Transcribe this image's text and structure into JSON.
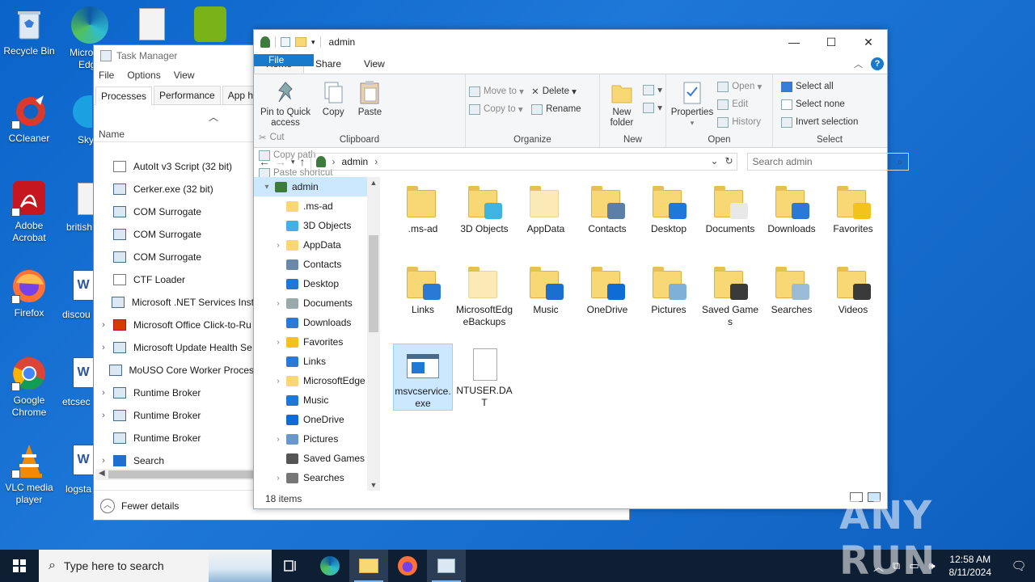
{
  "desktop": {
    "icons": [
      {
        "label": "Recycle Bin",
        "icon": "recycle-bin-icon"
      },
      {
        "label": "CCleaner",
        "icon": "ccleaner-icon"
      },
      {
        "label": "Adobe Acrobat",
        "icon": "adobe-acrobat-icon"
      },
      {
        "label": "Firefox",
        "icon": "firefox-icon"
      },
      {
        "label": "Google Chrome",
        "icon": "chrome-icon"
      },
      {
        "label": "VLC media player",
        "icon": "vlc-icon"
      }
    ],
    "partial_labels": [
      "Micro",
      "Edg",
      "Sky",
      "british",
      "discou",
      "etcsec",
      "logsta"
    ]
  },
  "taskmgr": {
    "title": "Task Manager",
    "menu": [
      "File",
      "Options",
      "View"
    ],
    "tabs": [
      "Processes",
      "Performance",
      "App histo"
    ],
    "column_name": "Name",
    "processes": [
      {
        "name": "AutoIt v3 Script (32 bit)",
        "expandable": false,
        "icon": "doc"
      },
      {
        "name": "Cerker.exe (32 bit)",
        "expandable": false,
        "icon": "app"
      },
      {
        "name": "COM Surrogate",
        "expandable": false,
        "icon": "app"
      },
      {
        "name": "COM Surrogate",
        "expandable": false,
        "icon": "app"
      },
      {
        "name": "COM Surrogate",
        "expandable": false,
        "icon": "app"
      },
      {
        "name": "CTF Loader",
        "expandable": false,
        "icon": "doc"
      },
      {
        "name": "Microsoft .NET Services Inst",
        "expandable": false,
        "icon": "app"
      },
      {
        "name": "Microsoft Office Click-to-Ru",
        "expandable": true,
        "icon": "office"
      },
      {
        "name": "Microsoft Update Health Se",
        "expandable": true,
        "icon": "app"
      },
      {
        "name": "MoUSO Core Worker Proces",
        "expandable": false,
        "icon": "app"
      },
      {
        "name": "Runtime Broker",
        "expandable": true,
        "icon": "app"
      },
      {
        "name": "Runtime Broker",
        "expandable": true,
        "icon": "app"
      },
      {
        "name": "Runtime Broker",
        "expandable": false,
        "icon": "app"
      },
      {
        "name": "Search",
        "expandable": true,
        "icon": "search"
      }
    ],
    "footer": "Fewer details"
  },
  "explorer": {
    "title": "admin",
    "ribbon_tabs": [
      "File",
      "Home",
      "Share",
      "View"
    ],
    "clipboard": {
      "pin": "Pin to Quick access",
      "copy": "Copy",
      "paste": "Paste",
      "cut": "Cut",
      "copy_path": "Copy path",
      "paste_shortcut": "Paste shortcut",
      "label": "Clipboard"
    },
    "organize": {
      "move_to": "Move to",
      "copy_to": "Copy to",
      "delete": "Delete",
      "rename": "Rename",
      "label": "Organize"
    },
    "new": {
      "new_folder": "New folder",
      "label": "New"
    },
    "open": {
      "properties": "Properties",
      "open": "Open",
      "edit": "Edit",
      "history": "History",
      "label": "Open"
    },
    "select": {
      "select_all": "Select all",
      "select_none": "Select none",
      "invert": "Invert selection",
      "label": "Select"
    },
    "address": "admin",
    "search_placeholder": "Search admin",
    "nav_items": [
      {
        "label": "admin",
        "arrow": "▾",
        "selected": true,
        "indent": 0
      },
      {
        "label": ".ms-ad",
        "arrow": "",
        "indent": 1
      },
      {
        "label": "3D Objects",
        "arrow": "",
        "indent": 1
      },
      {
        "label": "AppData",
        "arrow": "›",
        "indent": 1
      },
      {
        "label": "Contacts",
        "arrow": "",
        "indent": 1
      },
      {
        "label": "Desktop",
        "arrow": "",
        "indent": 1
      },
      {
        "label": "Documents",
        "arrow": "›",
        "indent": 1
      },
      {
        "label": "Downloads",
        "arrow": "",
        "indent": 1
      },
      {
        "label": "Favorites",
        "arrow": "›",
        "indent": 1
      },
      {
        "label": "Links",
        "arrow": "",
        "indent": 1
      },
      {
        "label": "MicrosoftEdge",
        "arrow": "›",
        "indent": 1
      },
      {
        "label": "Music",
        "arrow": "",
        "indent": 1
      },
      {
        "label": "OneDrive",
        "arrow": "",
        "indent": 1
      },
      {
        "label": "Pictures",
        "arrow": "›",
        "indent": 1
      },
      {
        "label": "Saved Games",
        "arrow": "",
        "indent": 1
      },
      {
        "label": "Searches",
        "arrow": "›",
        "indent": 1
      }
    ],
    "files": [
      {
        "label": ".ms-ad",
        "type": "folder"
      },
      {
        "label": "3D Objects",
        "type": "folder"
      },
      {
        "label": "AppData",
        "type": "folder-faded"
      },
      {
        "label": "Contacts",
        "type": "folder"
      },
      {
        "label": "Desktop",
        "type": "folder"
      },
      {
        "label": "Documents",
        "type": "folder"
      },
      {
        "label": "Downloads",
        "type": "folder"
      },
      {
        "label": "Favorites",
        "type": "folder"
      },
      {
        "label": "Links",
        "type": "folder"
      },
      {
        "label": "MicrosoftEdgeBackups",
        "type": "folder-faded"
      },
      {
        "label": "Music",
        "type": "folder"
      },
      {
        "label": "OneDrive",
        "type": "folder"
      },
      {
        "label": "Pictures",
        "type": "folder"
      },
      {
        "label": "Saved Games",
        "type": "folder"
      },
      {
        "label": "Searches",
        "type": "folder"
      },
      {
        "label": "Videos",
        "type": "folder"
      },
      {
        "label": "msvcservice.exe",
        "type": "exe",
        "selected": true
      },
      {
        "label": "NTUSER.DAT",
        "type": "file"
      }
    ],
    "status": "18 items"
  },
  "taskbar": {
    "search_placeholder": "Type here to search",
    "time": "12:58 AM",
    "date": "8/11/2024"
  },
  "watermark": "ANY RUN"
}
